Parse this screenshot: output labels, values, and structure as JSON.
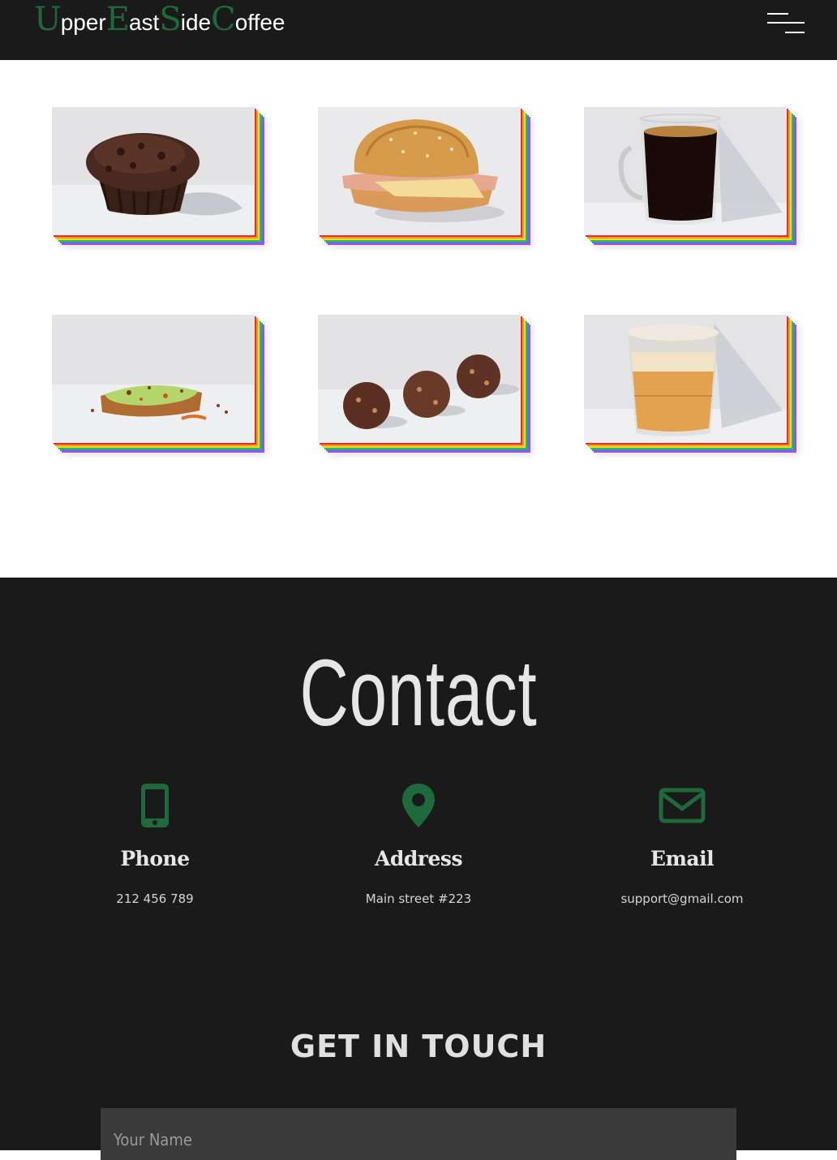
{
  "header": {
    "logo": [
      {
        "cap": "U",
        "rest": "pper"
      },
      {
        "cap": "E",
        "rest": "ast"
      },
      {
        "cap": "S",
        "rest": "ide"
      },
      {
        "cap": "C",
        "rest": "offee"
      }
    ],
    "menu_icon": "hamburger-menu-icon"
  },
  "gallery": {
    "items": [
      {
        "name": "chocolate-muffin"
      },
      {
        "name": "ham-cheese-sandwich"
      },
      {
        "name": "black-coffee-mug"
      },
      {
        "name": "avocado-toast"
      },
      {
        "name": "energy-bites"
      },
      {
        "name": "latte-glass"
      }
    ],
    "shadow_colors": [
      "#e03030",
      "#f39a1e",
      "#e9dd2a",
      "#3dbb4a",
      "#2f8be0",
      "#c143d6"
    ]
  },
  "contact": {
    "title": "Contact",
    "phone": {
      "icon": "phone-icon",
      "heading": "Phone",
      "value": "212 456 789"
    },
    "address": {
      "icon": "location-pin-icon",
      "heading": "Address",
      "value": "Main street #223"
    },
    "email": {
      "icon": "envelope-icon",
      "heading": "Email",
      "value": "support@gmail.com"
    },
    "form_title": "GET IN TOUCH",
    "name_placeholder": "Your Name"
  },
  "colors": {
    "accent": "#1e6a3c",
    "dark_bg": "#1a1a1a",
    "input_bg": "#3a3a3a"
  }
}
